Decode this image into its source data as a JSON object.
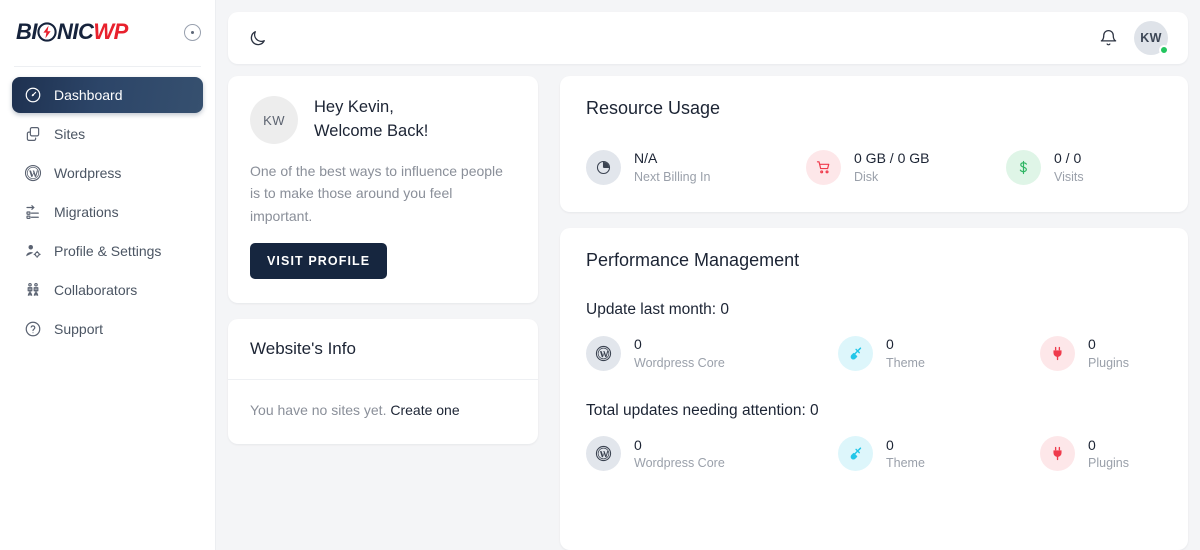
{
  "brand": {
    "part1": "BI",
    "part2": "NIC",
    "part3": "WP",
    "collapse_label": "collapse-sidebar"
  },
  "sidebar": {
    "items": [
      {
        "label": "Dashboard",
        "icon": "gauge-icon",
        "name": "sidebar-item-dashboard",
        "active": true
      },
      {
        "label": "Sites",
        "icon": "copy-icon",
        "name": "sidebar-item-sites",
        "active": false
      },
      {
        "label": "Wordpress",
        "icon": "wordpress-icon",
        "name": "sidebar-item-wordpress",
        "active": false
      },
      {
        "label": "Migrations",
        "icon": "migration-icon",
        "name": "sidebar-item-migrations",
        "active": false
      },
      {
        "label": "Profile & Settings",
        "icon": "user-gear-icon",
        "name": "sidebar-item-profile-settings",
        "active": false
      },
      {
        "label": "Collaborators",
        "icon": "people-icon",
        "name": "sidebar-item-collaborators",
        "active": false
      },
      {
        "label": "Support",
        "icon": "question-mark-icon",
        "name": "sidebar-item-support",
        "active": false
      }
    ]
  },
  "topbar": {
    "theme_toggle_icon": "moon-icon",
    "notifications_icon": "bell-icon",
    "avatar_initials": "KW",
    "status": "online"
  },
  "welcome": {
    "avatar_initials": "KW",
    "greeting_line1": "Hey Kevin,",
    "greeting_line2": "Welcome Back!",
    "quote": "One of the best ways to influence people is to make those around you feel important.",
    "button_label": "VISIT PROFILE"
  },
  "website_info": {
    "title": "Website's Info",
    "empty_text": "You have no sites yet.",
    "link_label": "Create one"
  },
  "resource_usage": {
    "title": "Resource Usage",
    "stats": [
      {
        "value": "N/A",
        "label": "Next Billing In",
        "icon": "pie-chart-icon",
        "circle": "c-grey",
        "name": "stat-next-billing"
      },
      {
        "value": "0 GB / 0 GB",
        "label": "Disk",
        "icon": "cart-icon",
        "circle": "c-red",
        "name": "stat-disk"
      },
      {
        "value": "0 / 0",
        "label": "Visits",
        "icon": "dollar-icon",
        "circle": "c-green",
        "name": "stat-visits"
      }
    ]
  },
  "performance": {
    "title": "Performance Management",
    "groups": [
      {
        "heading": "Update last month: 0",
        "name": "group-update-last-month",
        "stats": [
          {
            "value": "0",
            "label": "Wordpress Core",
            "icon": "wordpress-icon",
            "circle": "c-grey",
            "name": "stat-wordpress-core"
          },
          {
            "value": "0",
            "label": "Theme",
            "icon": "brush-icon",
            "circle": "c-cyan",
            "name": "stat-theme"
          },
          {
            "value": "0",
            "label": "Plugins",
            "icon": "plug-icon",
            "circle": "c-red",
            "name": "stat-plugins"
          }
        ]
      },
      {
        "heading": "Total updates needing attention: 0",
        "name": "group-needing-attention",
        "stats": [
          {
            "value": "0",
            "label": "Wordpress Core",
            "icon": "wordpress-icon",
            "circle": "c-grey",
            "name": "stat-wordpress-core"
          },
          {
            "value": "0",
            "label": "Theme",
            "icon": "brush-icon",
            "circle": "c-cyan",
            "name": "stat-theme"
          },
          {
            "value": "0",
            "label": "Plugins",
            "icon": "plug-icon",
            "circle": "c-red",
            "name": "stat-plugins"
          }
        ]
      }
    ]
  },
  "colors": {
    "brand_dark": "#16233c",
    "brand_red": "#e8212d",
    "accent_navy": "#16263f",
    "status_green": "#22c55e",
    "icon_red": "#ef3b4c",
    "icon_green": "#2eb563",
    "icon_cyan": "#23c6e8"
  }
}
